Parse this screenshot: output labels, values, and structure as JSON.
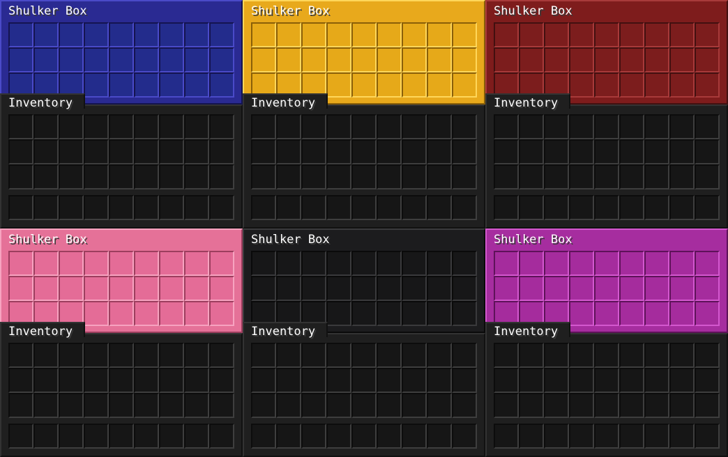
{
  "panels": [
    {
      "color": "blue",
      "base": "#2a2a92",
      "slot": "#232c8c",
      "highlight": "#4a4ac8",
      "shade": "#141450",
      "box_title": "Shulker Box",
      "inventory_title": "Inventory"
    },
    {
      "color": "yellow",
      "base": "#e8a91c",
      "slot": "#e6a919",
      "highlight": "#ffd75a",
      "shade": "#8a5f08",
      "box_title": "Shulker Box",
      "inventory_title": "Inventory"
    },
    {
      "color": "red",
      "base": "#7e1c1c",
      "slot": "#7c1d1d",
      "highlight": "#a83a3a",
      "shade": "#421010",
      "box_title": "Shulker Box",
      "inventory_title": "Inventory"
    },
    {
      "color": "pink",
      "base": "#e57198",
      "slot": "#e46c97",
      "highlight": "#f7a3c0",
      "shade": "#9c3e5e",
      "box_title": "Shulker Box",
      "inventory_title": "Inventory"
    },
    {
      "color": "black",
      "base": "#1c1c1e",
      "slot": "#171718",
      "highlight": "#3a3a3c",
      "shade": "#0a0a0a",
      "box_title": "Shulker Box",
      "inventory_title": "Inventory"
    },
    {
      "color": "magenta",
      "base": "#a62d9f",
      "slot": "#a52c9d",
      "highlight": "#d458cf",
      "shade": "#5e1259",
      "box_title": "Shulker Box",
      "inventory_title": "Inventory"
    }
  ],
  "slot_counts": {
    "shulker_box": 27,
    "inventory_main": 27,
    "hotbar": 9
  }
}
